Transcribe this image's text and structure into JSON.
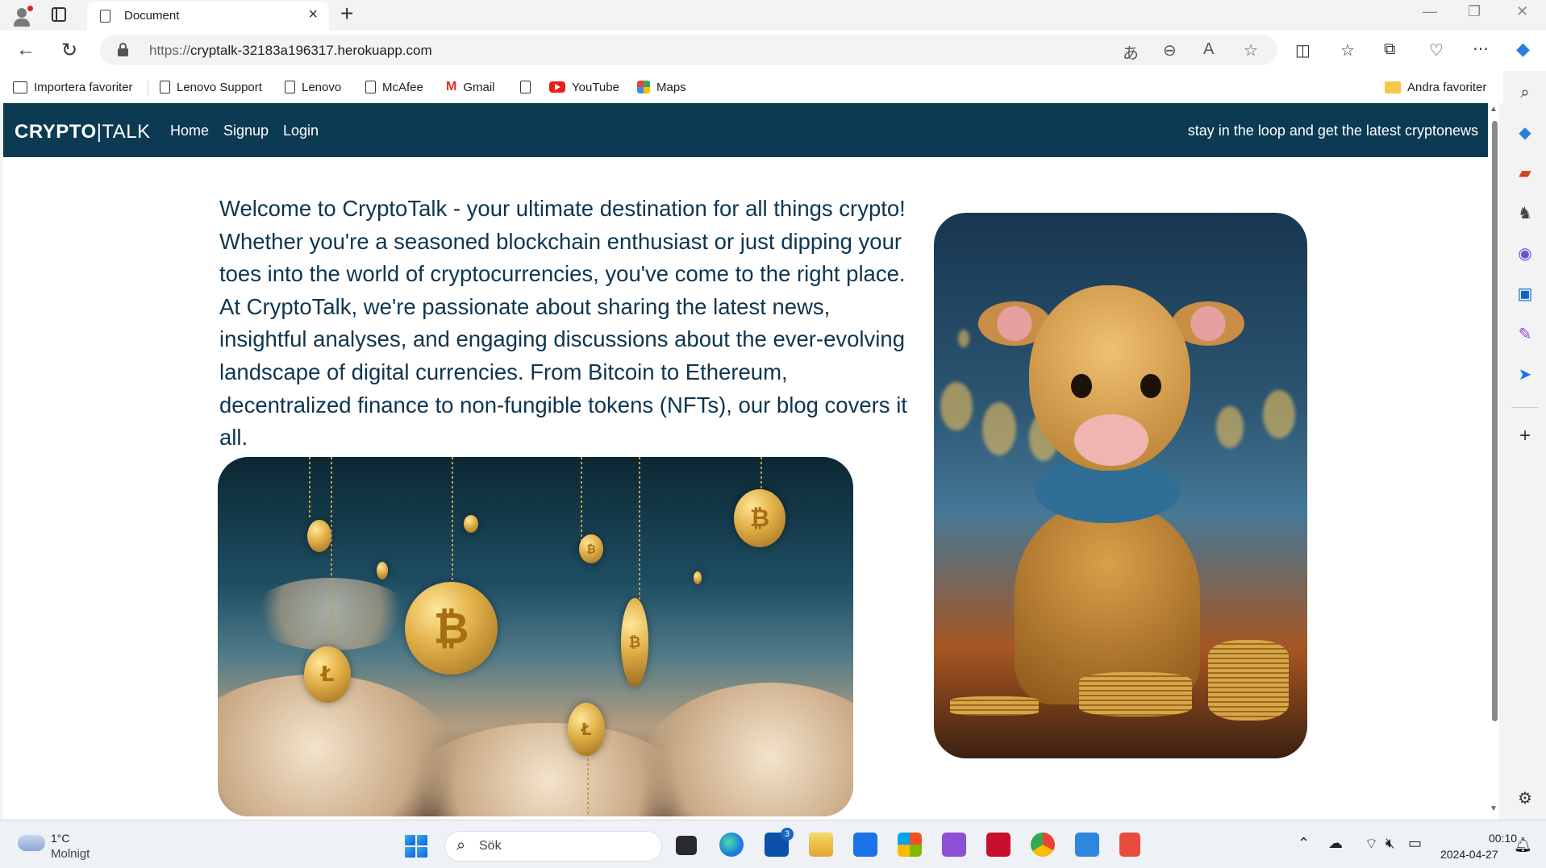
{
  "browser": {
    "tab_title": "Document",
    "url_protocol": "https://",
    "url_host": "cryptalk-32183a196317.herokuapp.com",
    "favorites": [
      {
        "label": "Importera favoriter"
      },
      {
        "label": "Lenovo Support"
      },
      {
        "label": "Lenovo"
      },
      {
        "label": "McAfee"
      },
      {
        "label": "Gmail"
      },
      {
        "label": ""
      },
      {
        "label": "YouTube"
      },
      {
        "label": "Maps"
      }
    ],
    "other_favorites": "Andra favoriter"
  },
  "site": {
    "logo_bold": "CRYPTO",
    "logo_light": "|TALK",
    "nav": [
      "Home",
      "Signup",
      "Login"
    ],
    "tagline": "stay in the loop and get the latest cryptonews",
    "intro": "Welcome to CryptoTalk - your ultimate destination for all things crypto! Whether you're a seasoned blockchain enthusiast or just dipping your toes into the world of cryptocurrencies, you've come to the right place. At CryptoTalk, we're passionate about sharing the latest news, insightful analyses, and engaging discussions about the ever-evolving landscape of digital currencies. From Bitcoin to Ethereum, decentralized finance to non-fungible tokens (NFTs), our blog covers it all."
  },
  "taskbar": {
    "temperature": "1°C",
    "condition": "Molnigt",
    "search_placeholder": "Sök",
    "time": "00:10",
    "date": "2024-04-27",
    "badge_count": "3"
  },
  "colors": {
    "nav_bg": "#0b3a52",
    "intro_text": "#0e3550"
  }
}
